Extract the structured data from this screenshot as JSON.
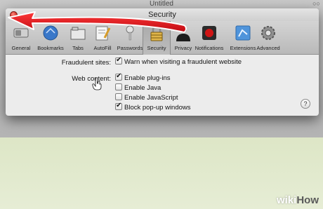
{
  "browser": {
    "title": "Untitled"
  },
  "dialog": {
    "title": "Security",
    "toolbar": [
      {
        "label": "General",
        "icon": "general-switch-icon"
      },
      {
        "label": "Bookmarks",
        "icon": "bookmarks-book-icon"
      },
      {
        "label": "Tabs",
        "icon": "tabs-icon"
      },
      {
        "label": "AutoFill",
        "icon": "autofill-pencil-icon"
      },
      {
        "label": "Passwords",
        "icon": "passwords-key-icon"
      },
      {
        "label": "Security",
        "icon": "lock-icon",
        "selected": true
      },
      {
        "label": "Privacy",
        "icon": "privacy-silhouette-icon"
      },
      {
        "label": "Notifications",
        "icon": "notifications-icon"
      },
      {
        "label": "Extensions",
        "icon": "extensions-puzzle-icon"
      },
      {
        "label": "Advanced",
        "icon": "advanced-gear-icon"
      }
    ],
    "fraudulent": {
      "label": "Fraudulent sites:",
      "option": {
        "label": "Warn when visiting a fraudulent website",
        "checked": true
      }
    },
    "web_content": {
      "label": "Web content:",
      "options": [
        {
          "label": "Enable plug-ins",
          "checked": true
        },
        {
          "label": "Enable Java",
          "checked": false
        },
        {
          "label": "Enable JavaScript",
          "checked": false
        },
        {
          "label": "Block pop-up windows",
          "checked": true
        }
      ]
    },
    "help_label": "?"
  },
  "annotation": {
    "arrow_color": "#e0141e"
  },
  "watermark": {
    "brand_light": "wiki",
    "brand_dark": "How"
  }
}
